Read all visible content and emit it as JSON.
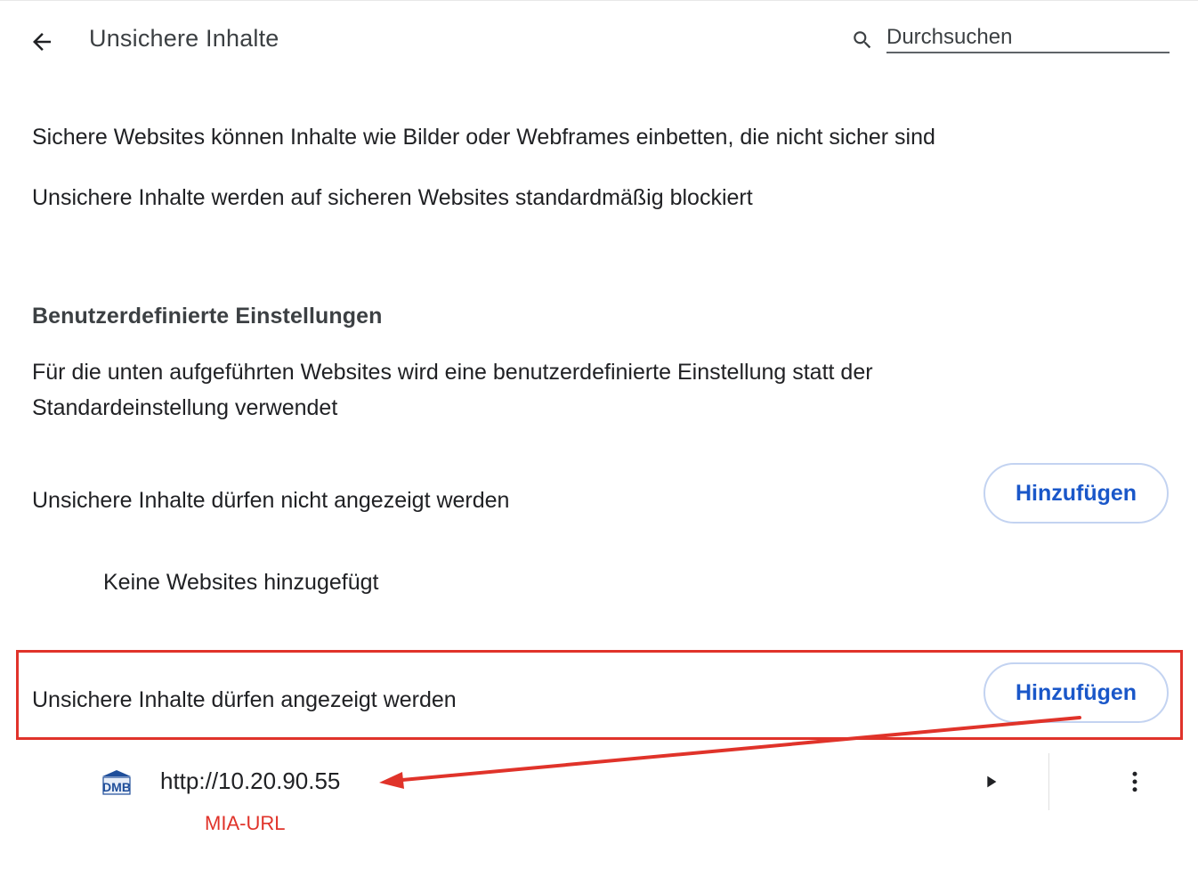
{
  "header": {
    "title": "Unsichere Inhalte",
    "search_placeholder": "Durchsuchen"
  },
  "description": {
    "line1": "Sichere Websites können Inhalte wie Bilder oder Webframes einbetten, die nicht sicher sind",
    "line2": "Unsichere Inhalte werden auf sicheren Websites standardmäßig blockiert"
  },
  "custom_settings": {
    "heading": "Benutzerdefinierte Einstellungen",
    "description_line1": "Für die unten aufgeführten Websites wird eine benutzerdefinierte Einstellung statt der",
    "description_line2": "Standardeinstellung verwendet"
  },
  "blocked_section": {
    "label": "Unsichere Inhalte dürfen nicht angezeigt werden",
    "add_label": "Hinzufügen",
    "empty_text": "Keine Websites hinzugefügt"
  },
  "allowed_section": {
    "label": "Unsichere Inhalte dürfen angezeigt werden",
    "add_label": "Hinzufügen",
    "sites": [
      {
        "url": "http://10.20.90.55",
        "favicon": "DMB"
      }
    ]
  },
  "annotation": {
    "label": "MIA-URL",
    "color": "#e0332a"
  },
  "colors": {
    "accent": "#1a57c9",
    "annotation": "#e0332a"
  }
}
